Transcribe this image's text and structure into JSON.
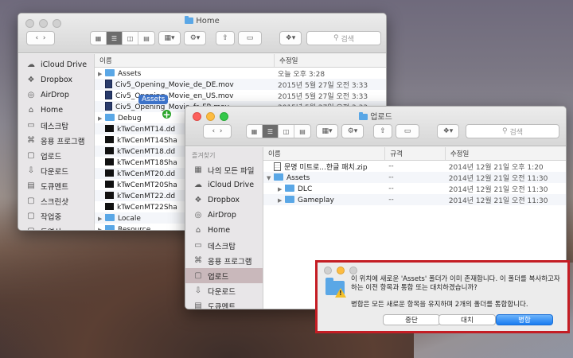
{
  "win1": {
    "title": "Home",
    "search_placeholder": "검색",
    "sidebar": [
      {
        "label": "iCloud Drive",
        "icon": "cloud-icon"
      },
      {
        "label": "Dropbox",
        "icon": "dropbox-icon"
      },
      {
        "label": "AirDrop",
        "icon": "airdrop-icon"
      },
      {
        "label": "Home",
        "icon": "home-icon"
      },
      {
        "label": "데스크탑",
        "icon": "desktop-icon"
      },
      {
        "label": "응용 프로그램",
        "icon": "apps-icon"
      },
      {
        "label": "업로드",
        "icon": "folder-icon"
      },
      {
        "label": "다운로드",
        "icon": "download-icon"
      },
      {
        "label": "도큐멘트",
        "icon": "document-icon"
      },
      {
        "label": "스크린샷",
        "icon": "folder-icon"
      },
      {
        "label": "작업중",
        "icon": "folder-icon"
      },
      {
        "label": "동영상",
        "icon": "folder-icon"
      }
    ],
    "col_name": "이름",
    "col_date": "수정일",
    "rows": [
      {
        "name": "Assets",
        "date": "오늘 오후 3:28",
        "kind": "folder",
        "tri": true
      },
      {
        "name": "Civ5_Opening_Movie_de_DE.mov",
        "date": "2015년 5월 27일 오전 3:33",
        "kind": "mov"
      },
      {
        "name": "Civ5_Opening_Movie_en_US.mov",
        "date": "2015년 5월 27일 오전 3:33",
        "kind": "mov"
      },
      {
        "name": "Civ5_Opening_Movie_fr_FR.mov",
        "date": "2015년 5월 27일 오전 3:33",
        "kind": "mov"
      },
      {
        "name": "Debug",
        "date": "",
        "kind": "folder",
        "tri": true
      },
      {
        "name": "kTwCenMT14.dd",
        "date": "",
        "kind": "blk"
      },
      {
        "name": "kTwCenMT14Sha",
        "date": "",
        "kind": "blk"
      },
      {
        "name": "kTwCenMT18.dd",
        "date": "",
        "kind": "blk"
      },
      {
        "name": "kTwCenMT18Sha",
        "date": "",
        "kind": "blk"
      },
      {
        "name": "kTwCenMT20.dd",
        "date": "",
        "kind": "blk"
      },
      {
        "name": "kTwCenMT20Sha",
        "date": "",
        "kind": "blk"
      },
      {
        "name": "kTwCenMT22.dd",
        "date": "",
        "kind": "blk"
      },
      {
        "name": "kTwCenMT22Sha",
        "date": "",
        "kind": "blk"
      },
      {
        "name": "Locale",
        "date": "",
        "kind": "folder",
        "tri": true
      },
      {
        "name": "Resource",
        "date": "",
        "kind": "folder",
        "tri": true
      }
    ],
    "drag_label": "Assets",
    "drag_plus": "+"
  },
  "win2": {
    "title": "업로드",
    "search_placeholder": "검색",
    "sidebar_header": "즐겨찾기",
    "sidebar": [
      {
        "label": "나의 모든 파일",
        "icon": "all-files-icon"
      },
      {
        "label": "iCloud Drive",
        "icon": "cloud-icon"
      },
      {
        "label": "Dropbox",
        "icon": "dropbox-icon"
      },
      {
        "label": "AirDrop",
        "icon": "airdrop-icon"
      },
      {
        "label": "Home",
        "icon": "home-icon"
      },
      {
        "label": "데스크탑",
        "icon": "desktop-icon"
      },
      {
        "label": "응용 프로그램",
        "icon": "apps-icon"
      },
      {
        "label": "업로드",
        "icon": "folder-icon",
        "active": true
      },
      {
        "label": "다운로드",
        "icon": "download-icon"
      },
      {
        "label": "도큐멘트",
        "icon": "document-icon"
      }
    ],
    "col_name": "이름",
    "col_size": "규격",
    "col_date": "수정일",
    "rows": [
      {
        "name": "문명 미트로...한글 패치.zip",
        "size": "--",
        "date": "2014년 12월 21일 오후 1:20",
        "kind": "zip",
        "indent": 0
      },
      {
        "name": "Assets",
        "size": "--",
        "date": "2014년 12월 21일 오전 11:30",
        "kind": "folder",
        "tri": "open",
        "indent": 0
      },
      {
        "name": "DLC",
        "size": "--",
        "date": "2014년 12월 21일 오전 11:30",
        "kind": "folder",
        "tri": "closed",
        "indent": 1
      },
      {
        "name": "Gameplay",
        "size": "--",
        "date": "2014년 12월 21일 오전 11:30",
        "kind": "folder",
        "tri": "closed",
        "indent": 1
      }
    ]
  },
  "dialog": {
    "message": "이 위치에 새로운 'Assets' 폴더가 이미 존재합니다. 이 폴더를 복사하고자 하는 이전 항목과 통합 또는 대치하겠습니까?",
    "info": "병합은 모든 새로운 항목을 유지하며 2개의 폴더를 통합합니다.",
    "buttons": {
      "stop": "중단",
      "replace": "대치",
      "merge": "병합"
    },
    "warning_glyph": "!"
  }
}
